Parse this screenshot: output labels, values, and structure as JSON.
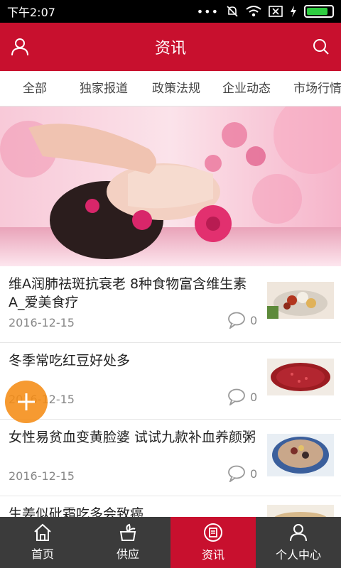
{
  "status_bar": {
    "time": "下午2:07",
    "battery_level": 0.85
  },
  "header": {
    "title": "资讯"
  },
  "tabs": [
    {
      "label": "全部",
      "selected": true
    },
    {
      "label": "独家报道"
    },
    {
      "label": "政策法规"
    },
    {
      "label": "企业动态"
    },
    {
      "label": "市场行情"
    }
  ],
  "news": [
    {
      "title": "维A润肺祛斑抗衰老 8种食物富含维生素A_爱美食疗",
      "date": "2016-12-15",
      "comments": "0"
    },
    {
      "title": "冬季常吃红豆好处多",
      "date": "2016-12-15",
      "comments": "0"
    },
    {
      "title": "女性易贫血变黄脸婆 试试九款补血养颜粥",
      "date": "2016-12-15",
      "comments": "0"
    },
    {
      "title": "生姜似砒霜吃多会致癌",
      "date": "",
      "comments": ""
    }
  ],
  "bottom_nav": [
    {
      "label": "首页",
      "icon": "home-icon"
    },
    {
      "label": "供应",
      "icon": "supply-icon"
    },
    {
      "label": "资讯",
      "icon": "news-icon",
      "active": true
    },
    {
      "label": "个人中心",
      "icon": "person-icon"
    }
  ],
  "colors": {
    "primary": "#c8102e",
    "nav_bg": "#3b3b3b",
    "fab": "#f58c14"
  }
}
